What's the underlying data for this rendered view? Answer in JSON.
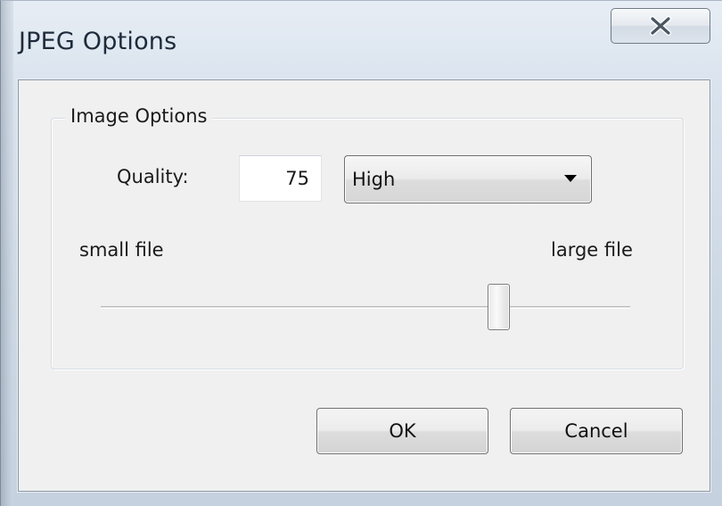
{
  "window": {
    "title": "JPEG Options"
  },
  "titlebar": {
    "close_icon": "close-icon"
  },
  "image_options": {
    "group_label": "Image Options",
    "quality_label": "Quality:",
    "quality_value": "75",
    "preset_select": {
      "selected": "High",
      "icon": "dropdown-arrow-icon"
    },
    "slider": {
      "min_label": "small file",
      "max_label": "large file",
      "position_fraction": 0.75
    }
  },
  "buttons": {
    "ok_label": "OK",
    "cancel_label": "Cancel"
  }
}
